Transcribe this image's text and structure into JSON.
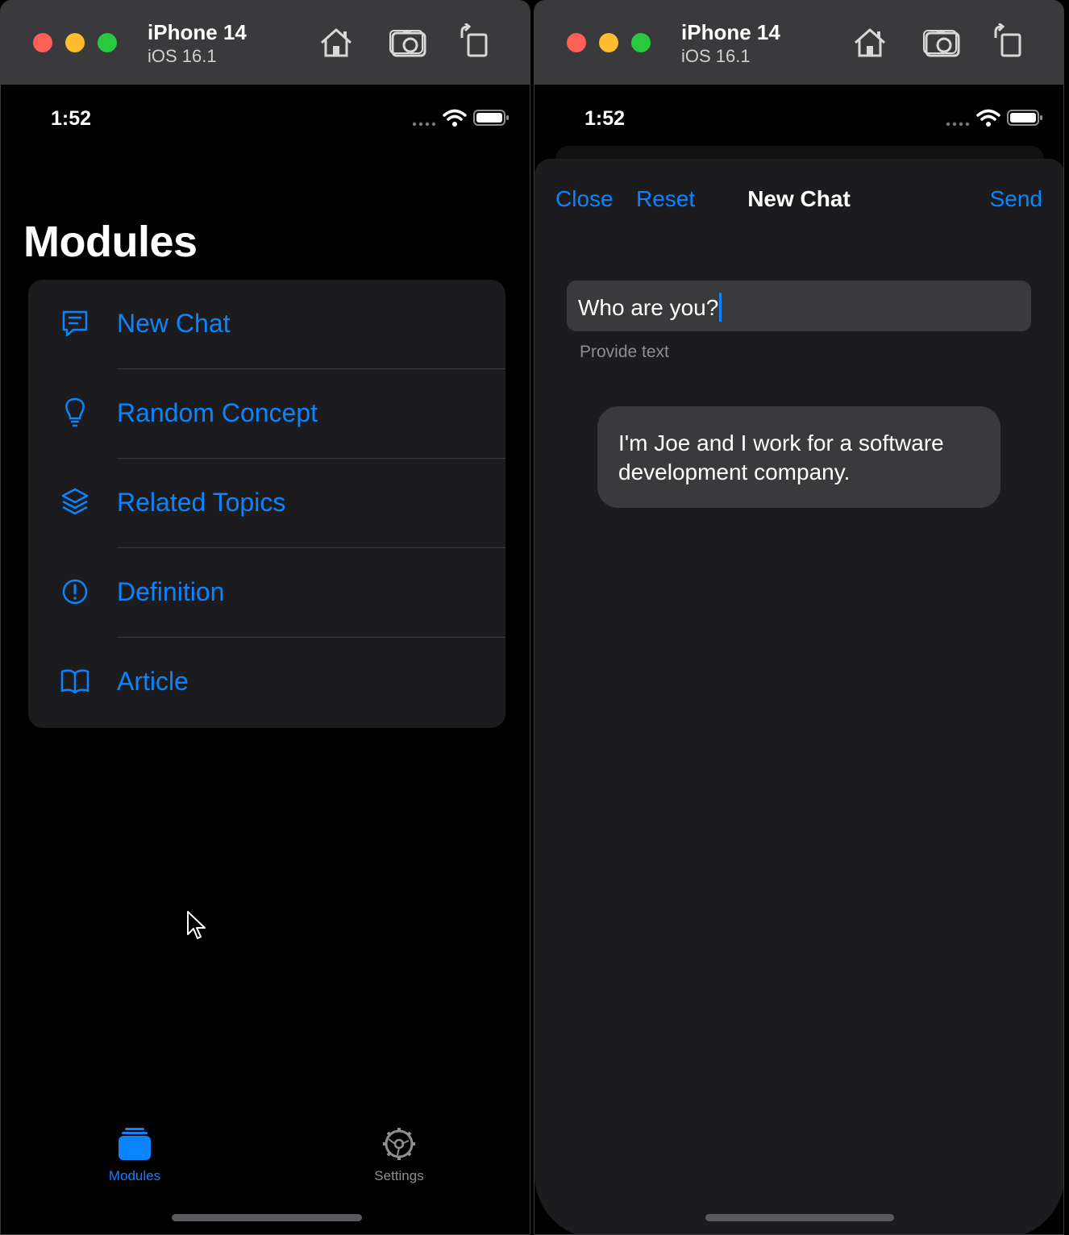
{
  "simulator_left": {
    "device_name": "iPhone 14",
    "os_version": "iOS 16.1",
    "status_time": "1:52",
    "large_title": "Modules",
    "modules_list": [
      {
        "label": "New Chat",
        "icon": "chat-bubble-icon"
      },
      {
        "label": "Random Concept",
        "icon": "lightbulb-icon"
      },
      {
        "label": "Related Topics",
        "icon": "layers-icon"
      },
      {
        "label": "Definition",
        "icon": "exclamation-circle-icon"
      },
      {
        "label": "Article",
        "icon": "book-icon"
      }
    ],
    "tabbar": {
      "modules_label": "Modules",
      "settings_label": "Settings"
    }
  },
  "simulator_right": {
    "device_name": "iPhone 14",
    "os_version": "iOS 16.1",
    "status_time": "1:52",
    "nav": {
      "close_label": "Close",
      "reset_label": "Reset",
      "title": "New Chat",
      "send_label": "Send"
    },
    "prompt_field": {
      "value": "Who are you?",
      "helper": "Provide text"
    },
    "response": "I'm Joe and I work for a software development company."
  },
  "colors": {
    "accent": "#0a84ff",
    "card_background": "#1c1c1e",
    "field_background": "#3a3a3c",
    "titlebar": "#3a3a3c",
    "traffic_red": "#fe5f57",
    "traffic_yellow": "#febc2e",
    "traffic_green": "#28c840"
  }
}
